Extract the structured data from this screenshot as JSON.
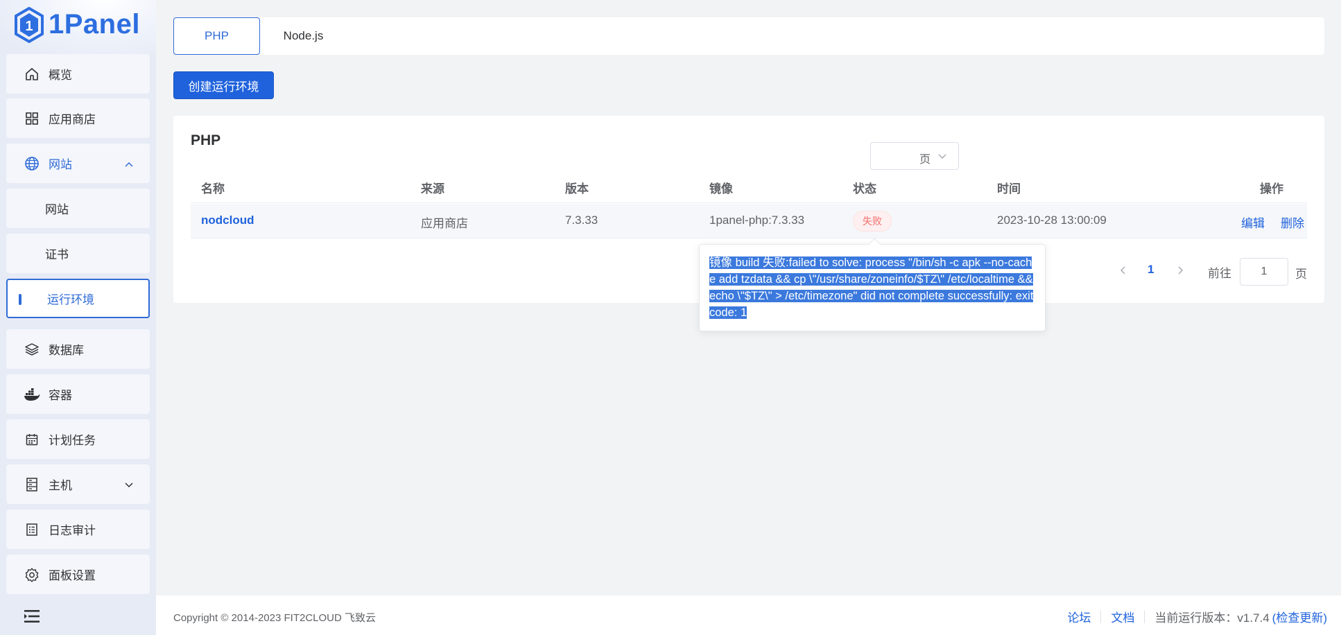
{
  "app": {
    "logo_text": "1Panel"
  },
  "sidebar": {
    "items": [
      {
        "label": "概览",
        "icon": "home-icon"
      },
      {
        "label": "应用商店",
        "icon": "grid-icon"
      },
      {
        "label": "网站",
        "icon": "globe-icon"
      },
      {
        "label": "网站"
      },
      {
        "label": "证书"
      },
      {
        "label": "运行环境"
      },
      {
        "label": "数据库",
        "icon": "layers-icon"
      },
      {
        "label": "容器",
        "icon": "docker-icon"
      },
      {
        "label": "计划任务",
        "icon": "calendar-icon"
      },
      {
        "label": "主机",
        "icon": "server-icon"
      },
      {
        "label": "日志审计",
        "icon": "log-icon"
      },
      {
        "label": "面板设置",
        "icon": "gear-icon"
      }
    ]
  },
  "tabs": [
    "PHP",
    "Node.js"
  ],
  "create_button": "创建运行环境",
  "table": {
    "title": "PHP",
    "headers": [
      "名称",
      "来源",
      "版本",
      "镜像",
      "状态",
      "时间",
      "操作"
    ],
    "rows": [
      {
        "name": "nodcloud",
        "source": "应用商店",
        "version": "7.3.33",
        "image": "1panel-php:7.3.33",
        "status": "失败",
        "time": "2023-10-28 13:00:09",
        "actions": [
          "编辑",
          "删除"
        ]
      }
    ]
  },
  "pagination": {
    "page_size_suffix": "页",
    "current_page": "1",
    "goto_label": "前往",
    "goto_value": "1",
    "page_suffix": "页"
  },
  "tooltip": {
    "text": "镜像 build 失败:failed to solve: process \"/bin/sh -c apk --no-cache add tzdata && cp \\\"/usr/share/zoneinfo/$TZ\\\" /etc/localtime && echo \\\"$TZ\\\" > /etc/timezone\" did not complete successfully: exit code: 1"
  },
  "footer": {
    "copyright": "Copyright © 2014-2023 FIT2CLOUD 飞致云",
    "forum": "论坛",
    "docs": "文档",
    "version": "当前运行版本：v1.7.4",
    "check_update": "(检查更新)"
  },
  "colors": {
    "primary": "#1f62dc",
    "danger": "#f56c6c"
  }
}
